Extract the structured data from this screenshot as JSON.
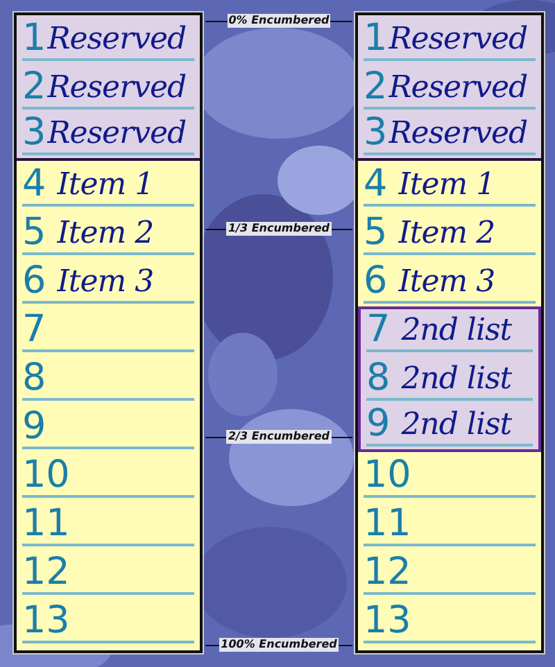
{
  "lists": [
    {
      "rows": [
        {
          "number": "1",
          "text": "Reserved",
          "kind": "reserved"
        },
        {
          "number": "2",
          "text": "Reserved",
          "kind": "reserved"
        },
        {
          "number": "3",
          "text": "Reserved",
          "kind": "reserved"
        },
        {
          "number": "4",
          "text": "Item 1",
          "kind": "item"
        },
        {
          "number": "5",
          "text": "Item 2",
          "kind": "item"
        },
        {
          "number": "6",
          "text": "Item 3",
          "kind": "item"
        },
        {
          "number": "7",
          "kind": "empty"
        },
        {
          "number": "8",
          "kind": "empty"
        },
        {
          "number": "9",
          "kind": "empty"
        },
        {
          "number": "10",
          "kind": "empty"
        },
        {
          "number": "11",
          "kind": "empty"
        },
        {
          "number": "12",
          "kind": "empty"
        },
        {
          "number": "13",
          "kind": "empty"
        }
      ]
    },
    {
      "rows": [
        {
          "number": "1",
          "text": "Reserved",
          "kind": "reserved"
        },
        {
          "number": "2",
          "text": "Reserved",
          "kind": "reserved"
        },
        {
          "number": "3",
          "text": "Reserved",
          "kind": "reserved"
        },
        {
          "number": "4",
          "text": "Item 1",
          "kind": "item"
        },
        {
          "number": "5",
          "text": "Item 2",
          "kind": "item"
        },
        {
          "number": "6",
          "text": "Item 3",
          "kind": "item"
        },
        {
          "number": "7",
          "text": "2nd list",
          "kind": "second"
        },
        {
          "number": "8",
          "text": "2nd list",
          "kind": "second"
        },
        {
          "number": "9",
          "text": "2nd list",
          "kind": "second"
        },
        {
          "number": "10",
          "kind": "empty"
        },
        {
          "number": "11",
          "kind": "empty"
        },
        {
          "number": "12",
          "kind": "empty"
        },
        {
          "number": "13",
          "kind": "empty"
        }
      ]
    }
  ],
  "markers": [
    "0% Encumbered",
    "1/3 Encumbered",
    "2/3 Encumbered",
    "100% Encumbered"
  ]
}
